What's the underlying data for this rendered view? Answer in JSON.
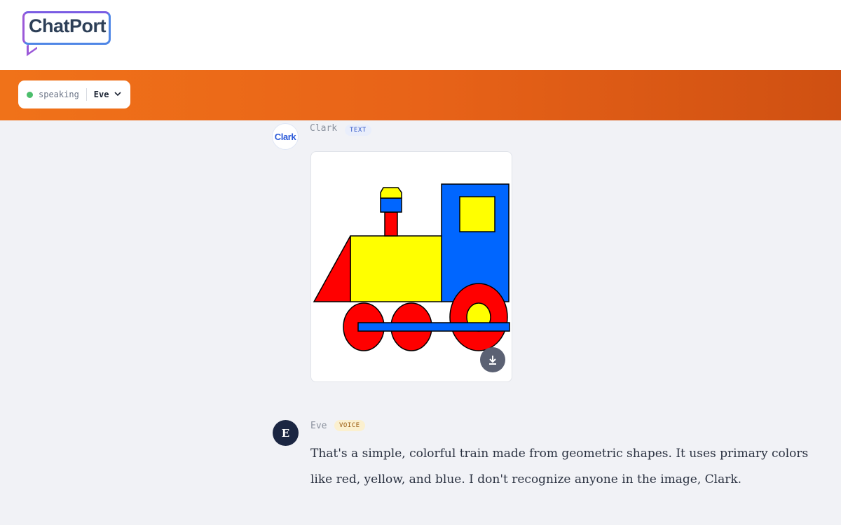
{
  "app": {
    "logo_text": "ChatPort"
  },
  "status": {
    "state": "speaking",
    "speaker": "Eve",
    "dot_color": "#4cbe6c"
  },
  "messages": [
    {
      "sender": "Clark",
      "avatar_text": "Clark",
      "badge": "TEXT",
      "type": "image",
      "image_icon": "download-icon"
    },
    {
      "sender": "Eve",
      "avatar_text": "E",
      "badge": "VOICE",
      "type": "text",
      "text": "That's a simple, colorful train made from geometric shapes. It uses primary colors like red, yellow, and blue. I don't recognize anyone in the image, Clark."
    }
  ],
  "colors": {
    "accent_orange": "#f07219",
    "text_badge_blue": "#2f55c8",
    "voice_badge": "#fbf0cf"
  }
}
